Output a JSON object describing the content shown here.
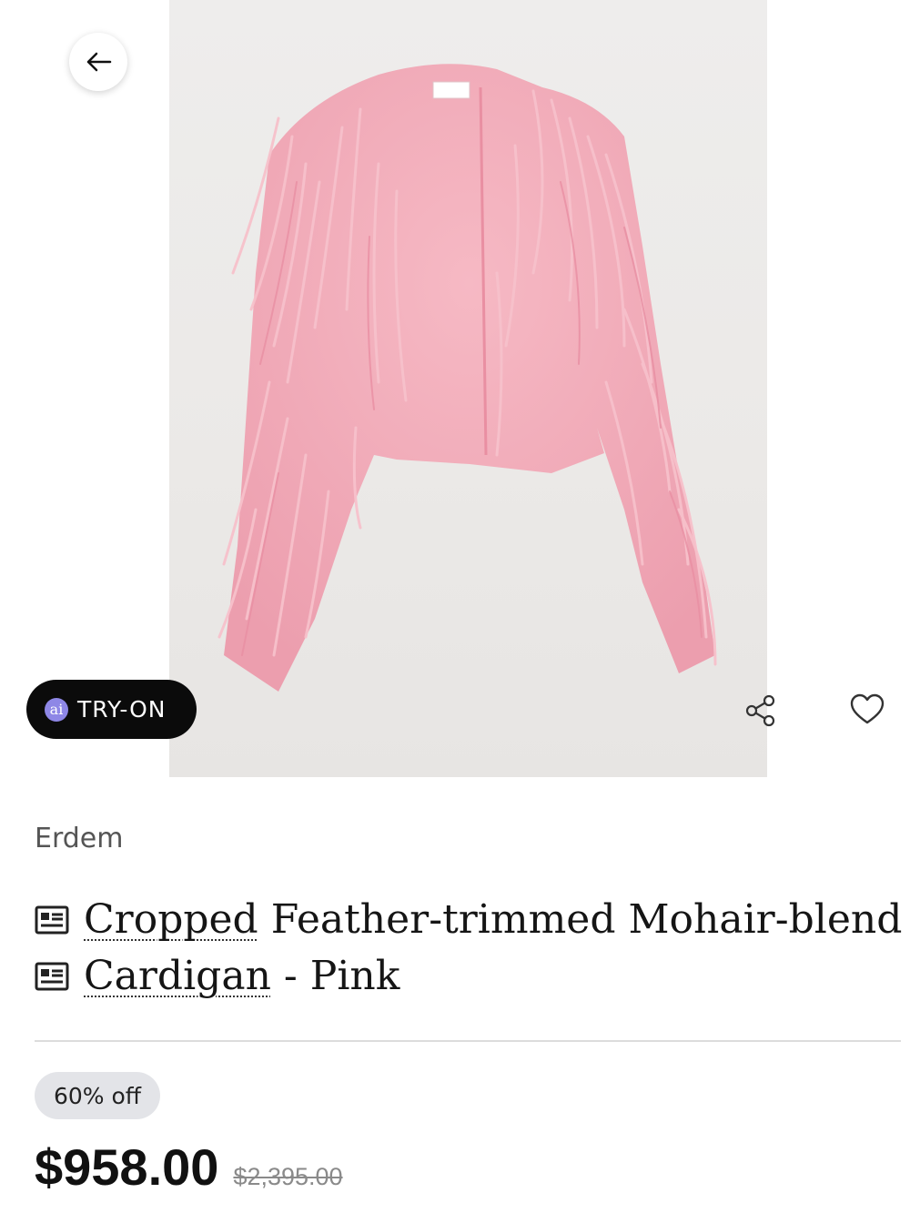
{
  "product": {
    "brand": "Erdem",
    "title_line1_link": "Cropped",
    "title_line1_rest": " Feather-trimmed Mohair-blend",
    "title_line2_link": "Cardigan",
    "title_line2_rest": " - Pink",
    "discount": "60% off",
    "price": "$958.00",
    "original_price": "$2,395.00",
    "image_subject": "pink feather-trimmed cardigan"
  },
  "actions": {
    "try_on_badge": "ai",
    "try_on_label": "TRY-ON",
    "back_icon": "arrow-left-icon",
    "share_icon": "share-icon",
    "wishlist_icon": "heart-icon",
    "title_link_icon": "document-icon"
  },
  "colors": {
    "garment_pink": "#f2a9b6",
    "try_on_background": "#0b0b0b",
    "ai_badge": "#8e87e6",
    "discount_badge_background": "#e3e4e8"
  }
}
